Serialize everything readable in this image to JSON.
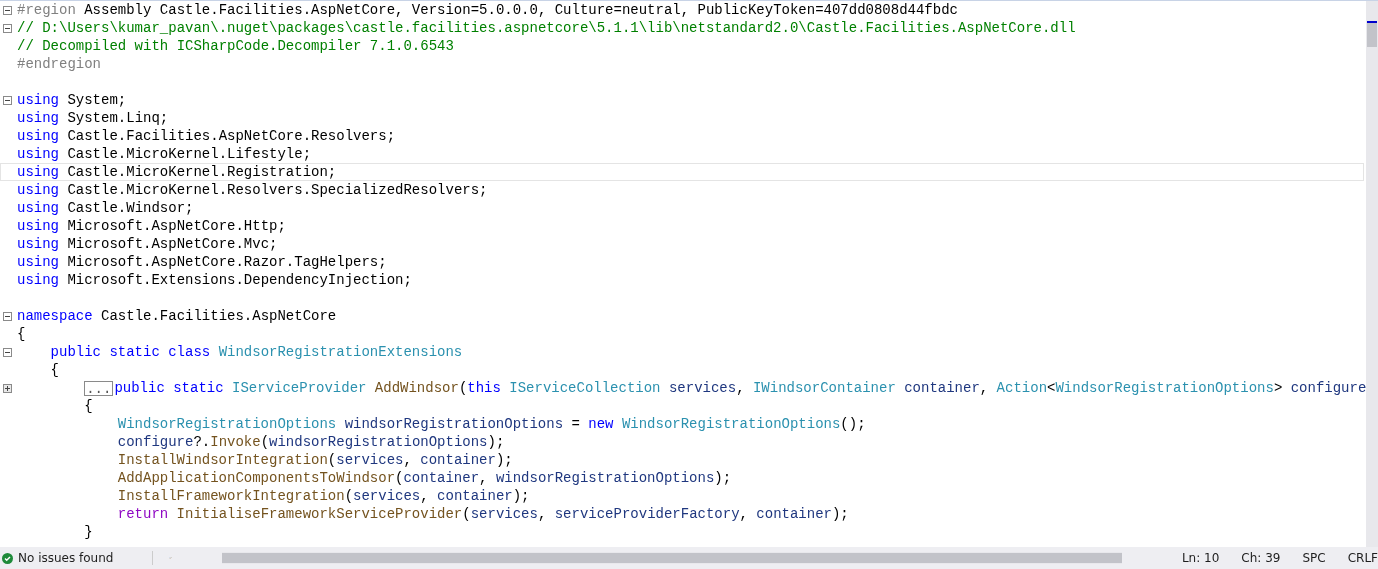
{
  "editor": {
    "lines": [
      {
        "kind": "code",
        "expanded": true,
        "tokens": [
          {
            "kind": "preproc",
            "text": "#region"
          },
          {
            "kind": "plain",
            "text": " Assembly Castle.Facilities.AspNetCore, Version=5.0.0.0, Culture=neutral, PublicKeyToken=407dd0808d44fbdc"
          }
        ]
      },
      {
        "kind": "code",
        "expanded": true,
        "tokens": [
          {
            "kind": "comment",
            "text": "// D:\\Users\\kumar_pavan\\.nuget\\packages\\castle.facilities.aspnetcore\\5.1.1\\lib\\netstandard2.0\\Castle.Facilities.AspNetCore.dll"
          }
        ]
      },
      {
        "kind": "code",
        "tokens": [
          {
            "kind": "comment",
            "text": "// Decompiled with ICSharpCode.Decompiler 7.1.0.6543"
          }
        ]
      },
      {
        "kind": "code",
        "tokens": [
          {
            "kind": "preproc",
            "text": "#endregion"
          }
        ]
      },
      {
        "kind": "blank"
      },
      {
        "kind": "code",
        "expanded": true,
        "tokens": [
          {
            "kind": "keyword",
            "text": "using"
          },
          {
            "kind": "plain",
            "text": " System;"
          }
        ]
      },
      {
        "kind": "code",
        "tokens": [
          {
            "kind": "keyword",
            "text": "using"
          },
          {
            "kind": "plain",
            "text": " System.Linq;"
          }
        ]
      },
      {
        "kind": "code",
        "tokens": [
          {
            "kind": "keyword",
            "text": "using"
          },
          {
            "kind": "plain",
            "text": " Castle.Facilities.AspNetCore.Resolvers;"
          }
        ]
      },
      {
        "kind": "code",
        "tokens": [
          {
            "kind": "keyword",
            "text": "using"
          },
          {
            "kind": "plain",
            "text": " Castle.MicroKernel.Lifestyle;"
          }
        ]
      },
      {
        "kind": "code",
        "current": true,
        "tokens": [
          {
            "kind": "keyword",
            "text": "using"
          },
          {
            "kind": "plain",
            "text": " Castle.MicroKernel.Registration;"
          }
        ]
      },
      {
        "kind": "code",
        "tokens": [
          {
            "kind": "keyword",
            "text": "using"
          },
          {
            "kind": "plain",
            "text": " Castle.MicroKernel.Resolvers.SpecializedResolvers;"
          }
        ]
      },
      {
        "kind": "code",
        "tokens": [
          {
            "kind": "keyword",
            "text": "using"
          },
          {
            "kind": "plain",
            "text": " Castle.Windsor;"
          }
        ]
      },
      {
        "kind": "code",
        "tokens": [
          {
            "kind": "keyword",
            "text": "using"
          },
          {
            "kind": "plain",
            "text": " Microsoft.AspNetCore.Http;"
          }
        ]
      },
      {
        "kind": "code",
        "tokens": [
          {
            "kind": "keyword",
            "text": "using"
          },
          {
            "kind": "plain",
            "text": " Microsoft.AspNetCore.Mvc;"
          }
        ]
      },
      {
        "kind": "code",
        "tokens": [
          {
            "kind": "keyword",
            "text": "using"
          },
          {
            "kind": "plain",
            "text": " Microsoft.AspNetCore.Razor.TagHelpers;"
          }
        ]
      },
      {
        "kind": "code",
        "tokens": [
          {
            "kind": "keyword",
            "text": "using"
          },
          {
            "kind": "plain",
            "text": " Microsoft.Extensions.DependencyInjection;"
          }
        ]
      },
      {
        "kind": "blank"
      },
      {
        "kind": "code",
        "expanded": true,
        "tokens": [
          {
            "kind": "keyword",
            "text": "namespace"
          },
          {
            "kind": "plain",
            "text": " Castle.Facilities.AspNetCore"
          }
        ]
      },
      {
        "kind": "code",
        "tokens": [
          {
            "kind": "plain",
            "text": "{"
          }
        ],
        "children": [
          {
            "kind": "code",
            "expanded": true,
            "tokens": [
              {
                "kind": "keyword",
                "text": "public static class"
              },
              {
                "kind": "type",
                "text": " WindsorRegistrationExtensions"
              }
            ]
          },
          {
            "kind": "code",
            "tokens": [
              {
                "kind": "plain",
                "text": "{"
              }
            ],
            "children": [
              {
                "kind": "code",
                "expanded": false,
                "tokens": [
                  {
                    "kind": "collapsed",
                    "text": "..."
                  },
                  {
                    "kind": "keyword",
                    "text": "public static"
                  },
                  {
                    "kind": "type",
                    "text": " IServiceProvider"
                  },
                  {
                    "kind": "method",
                    "text": " AddWindsor"
                  },
                  {
                    "kind": "plain",
                    "text": "("
                  },
                  {
                    "kind": "keyword",
                    "text": "this"
                  },
                  {
                    "kind": "type",
                    "text": " IServiceCollection"
                  },
                  {
                    "kind": "param",
                    "text": " services"
                  },
                  {
                    "kind": "plain",
                    "text": ","
                  },
                  {
                    "kind": "type",
                    "text": " IWindsorContainer"
                  },
                  {
                    "kind": "param",
                    "text": " container"
                  },
                  {
                    "kind": "plain",
                    "text": ","
                  },
                  {
                    "kind": "type",
                    "text": " Action"
                  },
                  {
                    "kind": "plain",
                    "text": "<"
                  },
                  {
                    "kind": "type",
                    "text": "WindsorRegistrationOptions"
                  },
                  {
                    "kind": "plain",
                    "text": ">"
                  },
                  {
                    "kind": "param",
                    "text": " configure"
                  }
                ]
              },
              {
                "kind": "code",
                "tokens": [
                  {
                    "kind": "plain",
                    "text": "{"
                  }
                ],
                "children": [
                  {
                    "kind": "code",
                    "tokens": [
                      {
                        "kind": "type",
                        "text": "WindsorRegistrationOptions"
                      },
                      {
                        "kind": "param",
                        "text": " windsorRegistrationOptions"
                      },
                      {
                        "kind": "plain",
                        "text": " ="
                      },
                      {
                        "kind": "keyword",
                        "text": " new"
                      },
                      {
                        "kind": "type",
                        "text": " WindsorRegistrationOptions"
                      },
                      {
                        "kind": "plain",
                        "text": "();"
                      }
                    ]
                  },
                  {
                    "kind": "code",
                    "tokens": [
                      {
                        "kind": "param",
                        "text": "configure"
                      },
                      {
                        "kind": "plain",
                        "text": "?."
                      },
                      {
                        "kind": "method",
                        "text": "Invoke"
                      },
                      {
                        "kind": "plain",
                        "text": "("
                      },
                      {
                        "kind": "param",
                        "text": "windsorRegistrationOptions"
                      },
                      {
                        "kind": "plain",
                        "text": ");"
                      }
                    ]
                  },
                  {
                    "kind": "code",
                    "tokens": [
                      {
                        "kind": "method",
                        "text": "InstallWindsorIntegration"
                      },
                      {
                        "kind": "plain",
                        "text": "("
                      },
                      {
                        "kind": "param",
                        "text": "services"
                      },
                      {
                        "kind": "plain",
                        "text": ","
                      },
                      {
                        "kind": "param",
                        "text": " container"
                      },
                      {
                        "kind": "plain",
                        "text": ");"
                      }
                    ]
                  },
                  {
                    "kind": "code",
                    "tokens": [
                      {
                        "kind": "method",
                        "text": "AddApplicationComponentsToWindsor"
                      },
                      {
                        "kind": "plain",
                        "text": "("
                      },
                      {
                        "kind": "param",
                        "text": "container"
                      },
                      {
                        "kind": "plain",
                        "text": ","
                      },
                      {
                        "kind": "param",
                        "text": " windsorRegistrationOptions"
                      },
                      {
                        "kind": "plain",
                        "text": ");"
                      }
                    ]
                  },
                  {
                    "kind": "code",
                    "tokens": [
                      {
                        "kind": "method",
                        "text": "InstallFrameworkIntegration"
                      },
                      {
                        "kind": "plain",
                        "text": "("
                      },
                      {
                        "kind": "param",
                        "text": "services"
                      },
                      {
                        "kind": "plain",
                        "text": ","
                      },
                      {
                        "kind": "param",
                        "text": " container"
                      },
                      {
                        "kind": "plain",
                        "text": ");"
                      }
                    ]
                  },
                  {
                    "kind": "code",
                    "tokens": [
                      {
                        "kind": "control",
                        "text": "return"
                      },
                      {
                        "kind": "method",
                        "text": " InitialiseFrameworkServiceProvider"
                      },
                      {
                        "kind": "plain",
                        "text": "("
                      },
                      {
                        "kind": "param",
                        "text": "services"
                      },
                      {
                        "kind": "plain",
                        "text": ","
                      },
                      {
                        "kind": "param",
                        "text": " serviceProviderFactory"
                      },
                      {
                        "kind": "plain",
                        "text": ","
                      },
                      {
                        "kind": "param",
                        "text": " container"
                      },
                      {
                        "kind": "plain",
                        "text": ");"
                      }
                    ]
                  }
                ]
              },
              {
                "kind": "code",
                "tokens": [
                  {
                    "kind": "plain",
                    "text": "}"
                  }
                ]
              }
            ]
          }
        ]
      }
    ]
  },
  "status_bar": {
    "issues": "No issues found",
    "line": "Ln: 10",
    "column": "Ch: 39",
    "whitespace": "SPC",
    "line_ending": "CRLF"
  }
}
